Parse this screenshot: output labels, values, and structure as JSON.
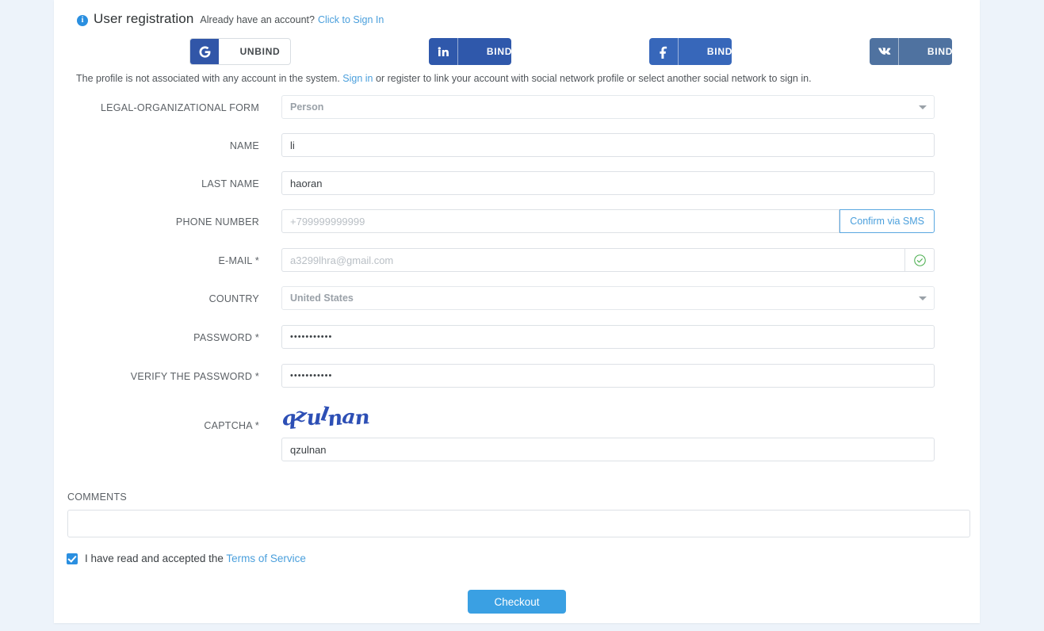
{
  "header": {
    "info_icon": "info-icon",
    "title": "User registration",
    "subtitle": "Already have an account?",
    "signin_link": "Click to Sign In"
  },
  "social": [
    {
      "network": "google",
      "icon": "google-icon",
      "label": "UNBIND",
      "color": "#3156a8"
    },
    {
      "network": "linkedin",
      "icon": "linkedin-icon",
      "label": "BIND",
      "color": "#2f58ab"
    },
    {
      "network": "facebook",
      "icon": "facebook-icon",
      "label": "BIND",
      "color": "#3767ba"
    },
    {
      "network": "vk",
      "icon": "vk-icon",
      "label": "BIND",
      "color": "#4f72a0"
    }
  ],
  "notice": {
    "part1": "The profile is not associated with any account in the system. ",
    "link": "Sign in",
    "part2": " or register to link your account with social network profile or select another social network to sign in."
  },
  "form": {
    "legal_form": {
      "label": "LEGAL-ORGANIZATIONAL FORM",
      "value": "Person"
    },
    "name": {
      "label": "NAME",
      "value": "li"
    },
    "last_name": {
      "label": "LAST NAME",
      "value": "haoran"
    },
    "phone": {
      "label": "PHONE NUMBER",
      "placeholder": "+799999999999",
      "value": "",
      "sms_button": "Confirm via SMS"
    },
    "email": {
      "label": "E-MAIL *",
      "value": "a3299lhra@gmail.com",
      "status_icon": "check-circle-icon",
      "status_color": "#4caf50"
    },
    "country": {
      "label": "COUNTRY",
      "value": "United States"
    },
    "password": {
      "label": "PASSWORD *",
      "value": "•••••••••••"
    },
    "verify_password": {
      "label": "VERIFY THE PASSWORD *",
      "value": "•••••••••••"
    },
    "captcha": {
      "label": "CAPTCHA *",
      "image_text": "qzulnan",
      "value": "qzulnan"
    },
    "comments": {
      "label": "COMMENTS",
      "value": ""
    }
  },
  "terms": {
    "text": "I have read and accepted the ",
    "link": "Terms of Service",
    "checked": true
  },
  "checkout": {
    "label": "Checkout",
    "color": "#3aa0e3"
  }
}
